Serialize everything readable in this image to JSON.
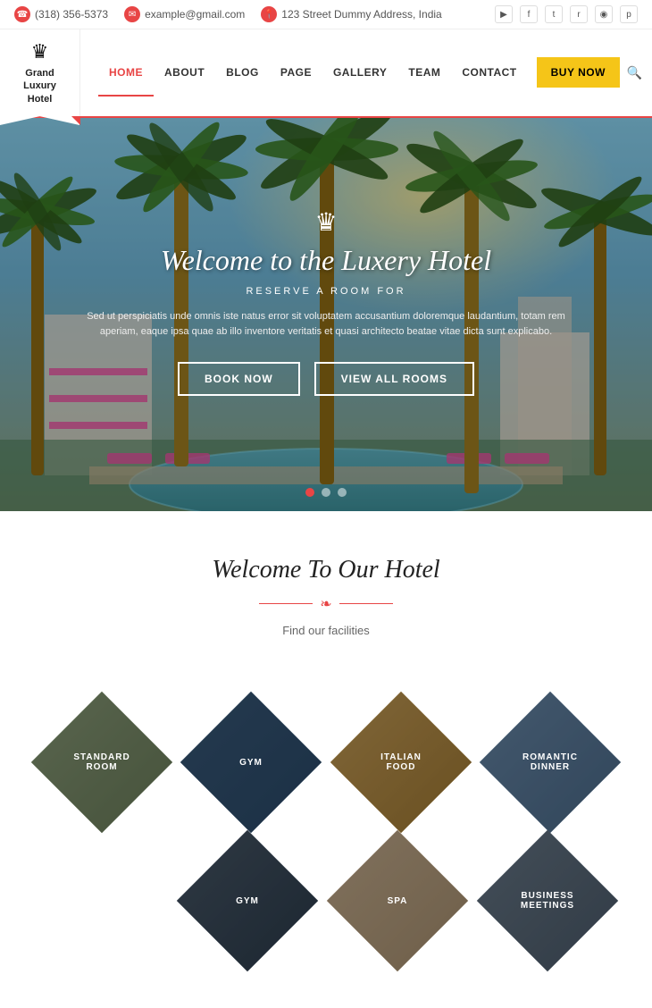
{
  "topbar": {
    "phone": "(318) 356-5373",
    "email": "example@gmail.com",
    "address": "123 Street Dummy Address, India",
    "socials": [
      "▶",
      "f",
      "t",
      "RSS",
      "📷",
      "p"
    ]
  },
  "logo": {
    "text": "Grand\nLuxury\nHotel"
  },
  "nav": {
    "items": [
      {
        "label": "HOME",
        "active": true
      },
      {
        "label": "ABOUT",
        "active": false
      },
      {
        "label": "BLOG",
        "active": false
      },
      {
        "label": "PAGE",
        "active": false
      },
      {
        "label": "GALLERY",
        "active": false
      },
      {
        "label": "TEAM",
        "active": false
      },
      {
        "label": "CONTACT",
        "active": false
      }
    ],
    "buy_label": "BUY NOW"
  },
  "hero": {
    "crown": "♛",
    "title": "Welcome to the Luxery Hotel",
    "subtitle": "RESERVE A ROOM FOR",
    "description": "Sed ut perspiciatis unde omnis iste natus error sit voluptatem accusantium doloremque laudantium, totam rem aperiam, eaque ipsa quae ab illo inventore veritatis et quasi architecto beatae vitae dicta sunt explicabo.",
    "btn_book": "Book Now",
    "btn_rooms": "VIEW ALL ROOMS",
    "dots": [
      true,
      false,
      false
    ]
  },
  "welcome": {
    "title": "Welcome To Our Hotel",
    "ornament": "❧",
    "subtitle": "Find our facilities"
  },
  "facilities": {
    "row1": [
      {
        "label": "STANDARD ROOM",
        "color": "#8B9E7A"
      },
      {
        "label": "GYM",
        "color": "#5a6e8a"
      },
      {
        "label": "ITALIAN FOOD",
        "color": "#c8a05a"
      },
      {
        "label": "ROMANTIC DINNER",
        "color": "#6a8aaa"
      }
    ],
    "row2": [
      {
        "label": "GYM",
        "color": "#4a5a6a"
      },
      {
        "label": "SPA",
        "color": "#c8b090"
      },
      {
        "label": "BUSINESS MEETINGS",
        "color": "#6a7a8a"
      }
    ]
  }
}
